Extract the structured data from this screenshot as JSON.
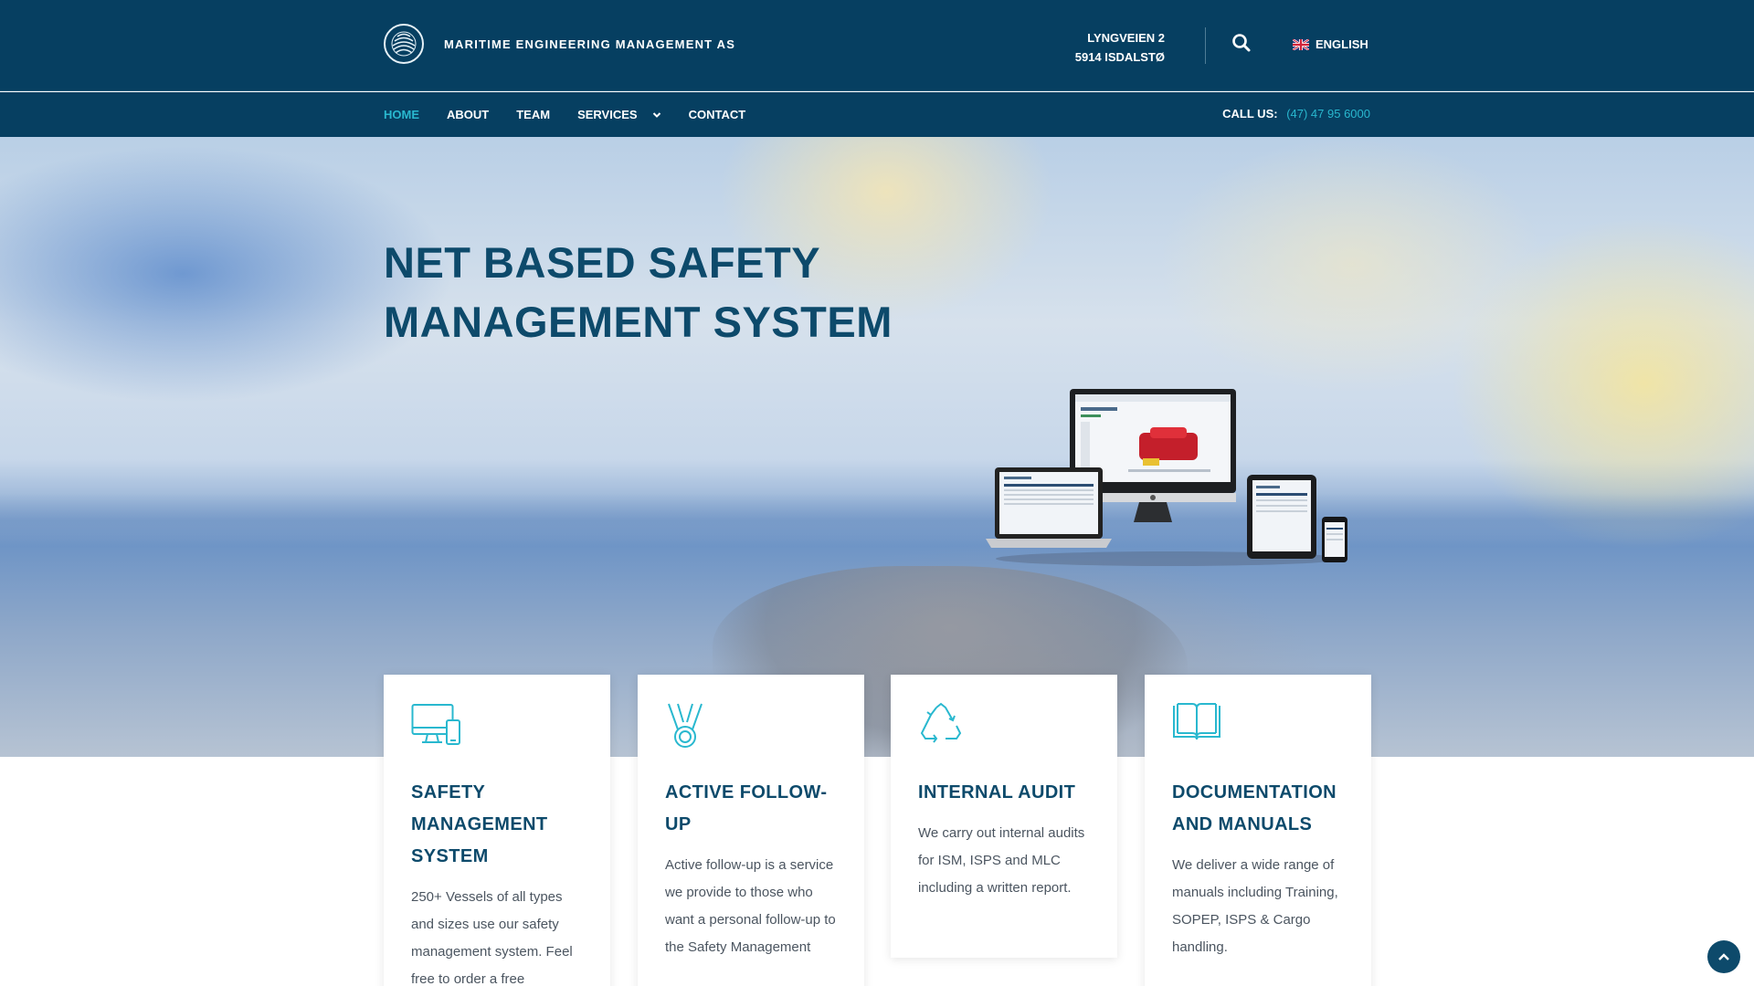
{
  "header": {
    "company_name": "MARITIME ENGINEERING MANAGEMENT AS",
    "address_line1": "LYNGVEIEN 2",
    "address_line2": "5914 ISDALSTØ",
    "language": "ENGLISH"
  },
  "nav": {
    "items": [
      {
        "label": "HOME"
      },
      {
        "label": "ABOUT"
      },
      {
        "label": "TEAM"
      },
      {
        "label": "SERVICES"
      },
      {
        "label": "CONTACT"
      }
    ],
    "call_label": "CALL US:",
    "phone": "(47) 47 95 6000"
  },
  "hero": {
    "title": "NET BASED SAFETY MANAGEMENT SYSTEM"
  },
  "cards": [
    {
      "icon": "monitor-devices-icon",
      "title": "SAFETY MANAGEMENT SYSTEM",
      "text": "250+ Vessels of all types and sizes use our safety management system. Feel free to order a free"
    },
    {
      "icon": "medal-icon",
      "title": "ACTIVE FOLLOW-UP",
      "text": "Active follow-up is a service we provide to those who want a personal follow-up to the Safety Management"
    },
    {
      "icon": "recycle-icon",
      "title": "INTERNAL AUDIT",
      "text": "We carry out internal audits for ISM, ISPS and MLC including a written report."
    },
    {
      "icon": "book-icon",
      "title": "DOCUMENTATION AND MANUALS",
      "text": "We deliver a wide range of manuals including Training, SOPEP, ISPS & Cargo handling."
    }
  ],
  "colors": {
    "primary": "#063f61",
    "accent": "#29b8cf",
    "heading": "#0d4a6b"
  }
}
